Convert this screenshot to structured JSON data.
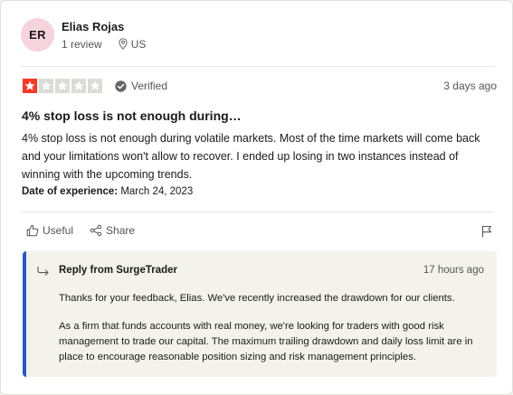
{
  "reviewer": {
    "initials": "ER",
    "name": "Elias Rojas",
    "review_count": "1 review",
    "country": "US"
  },
  "rating": {
    "stars": 1,
    "max_stars": 5,
    "verified_label": "Verified",
    "date_ago": "3 days ago"
  },
  "review": {
    "title": "4% stop loss is not enough during…",
    "body": "4% stop loss is not enough during volatile markets. Most of the time markets will come back and your limitations won't allow to recover. I ended up losing in two instances instead of winning with the upcoming trends.",
    "experience_label": "Date of experience:",
    "experience_date": "March 24, 2023"
  },
  "actions": {
    "useful_label": "Useful",
    "share_label": "Share"
  },
  "reply": {
    "from": "Reply from SurgeTrader",
    "date_ago": "17 hours ago",
    "paragraph1": "Thanks for your feedback, Elias. We've recently increased the drawdown for our clients.",
    "paragraph2": "As a firm that funds accounts with real money, we're looking for traders with good risk management to trade our capital. The maximum trailing drawdown and daily loss limit are in place to encourage reasonable position sizing and risk management principles."
  },
  "colors": {
    "star_filled": "#ff3722",
    "star_empty": "#dcdcd6",
    "avatar_bg": "#f7d3dc",
    "reply_accent": "#2458d3",
    "reply_bg": "#f3f3ec"
  }
}
